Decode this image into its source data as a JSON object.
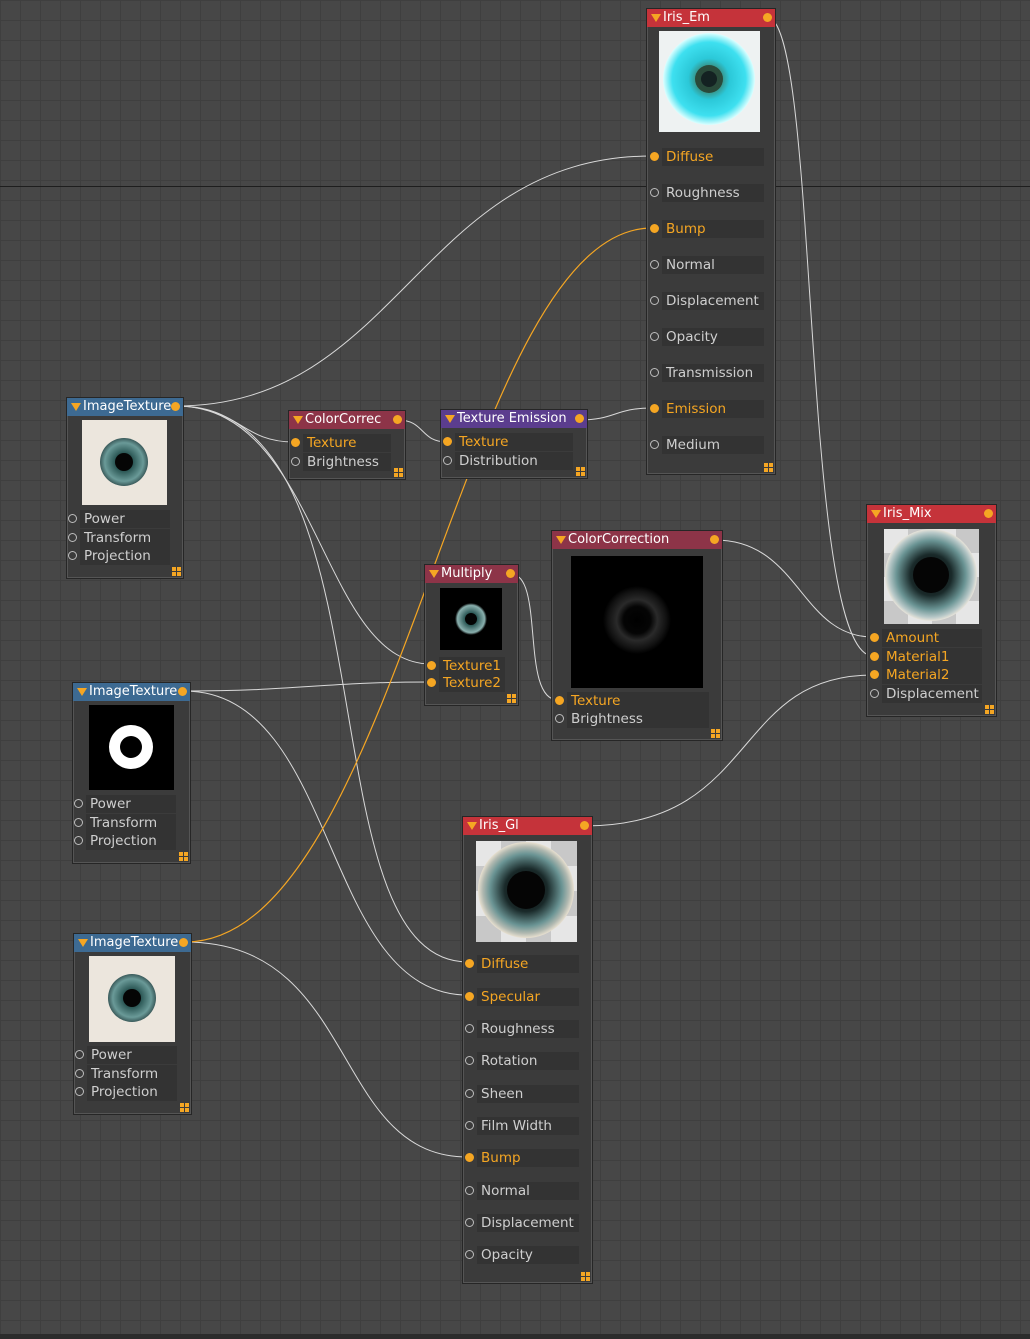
{
  "colors": {
    "wire_white": "#d9d9d9",
    "wire_orange": "#f5a623",
    "active_port": "#f5a623"
  },
  "nodes": {
    "iris_em": {
      "title": "Iris_Em",
      "ports": [
        "Diffuse",
        "Roughness",
        "Bump",
        "Normal",
        "Displacement",
        "Opacity",
        "Transmission",
        "Emission",
        "Medium"
      ]
    },
    "image_texture_1": {
      "title": "ImageTexture",
      "ports": [
        "Power",
        "Transform",
        "Projection"
      ]
    },
    "color_correc": {
      "title": "ColorCorrec",
      "ports": [
        "Texture",
        "Brightness"
      ]
    },
    "texture_emission": {
      "title": "Texture Emission",
      "ports": [
        "Texture",
        "Distribution"
      ]
    },
    "multiply": {
      "title": "Multiply",
      "ports": [
        "Texture1",
        "Texture2"
      ]
    },
    "color_correction": {
      "title": "ColorCorrection",
      "ports": [
        "Texture",
        "Brightness"
      ]
    },
    "iris_mix": {
      "title": "Iris_Mix",
      "ports": [
        "Amount",
        "Material1",
        "Material2",
        "Displacement"
      ]
    },
    "image_texture_2": {
      "title": "ImageTexture",
      "ports": [
        "Power",
        "Transform",
        "Projection"
      ]
    },
    "iris_gl": {
      "title": "Iris_Gl",
      "ports": [
        "Diffuse",
        "Specular",
        "Roughness",
        "Rotation",
        "Sheen",
        "Film Width",
        "Bump",
        "Normal",
        "Displacement",
        "Opacity"
      ]
    },
    "image_texture_3": {
      "title": "ImageTexture",
      "ports": [
        "Power",
        "Transform",
        "Projection"
      ]
    }
  }
}
